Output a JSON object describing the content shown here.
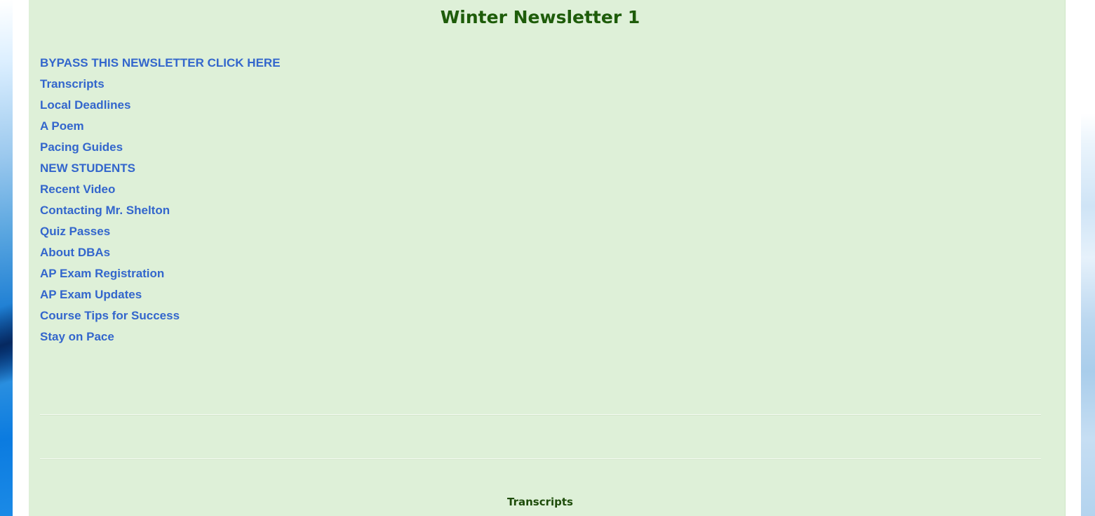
{
  "newsletter": {
    "title": "Winter Newsletter 1",
    "links": [
      {
        "label": "BYPASS THIS NEWSLETTER CLICK HERE"
      },
      {
        "label": "Transcripts"
      },
      {
        "label": "Local Deadlines"
      },
      {
        "label": "A Poem"
      },
      {
        "label": "Pacing Guides"
      },
      {
        "label": "NEW STUDENTS"
      },
      {
        "label": "Recent Video"
      },
      {
        "label": "Contacting Mr. Shelton"
      },
      {
        "label": "Quiz Passes"
      },
      {
        "label": "About DBAs"
      },
      {
        "label": "AP Exam Registration"
      },
      {
        "label": "AP Exam Updates"
      },
      {
        "label": "Course Tips for Success"
      },
      {
        "label": "Stay on Pace"
      }
    ],
    "section_heading": "Transcripts"
  },
  "colors": {
    "content_background": "#def0d8",
    "title_color": "#1e5c0a",
    "link_color": "#3366cc"
  }
}
